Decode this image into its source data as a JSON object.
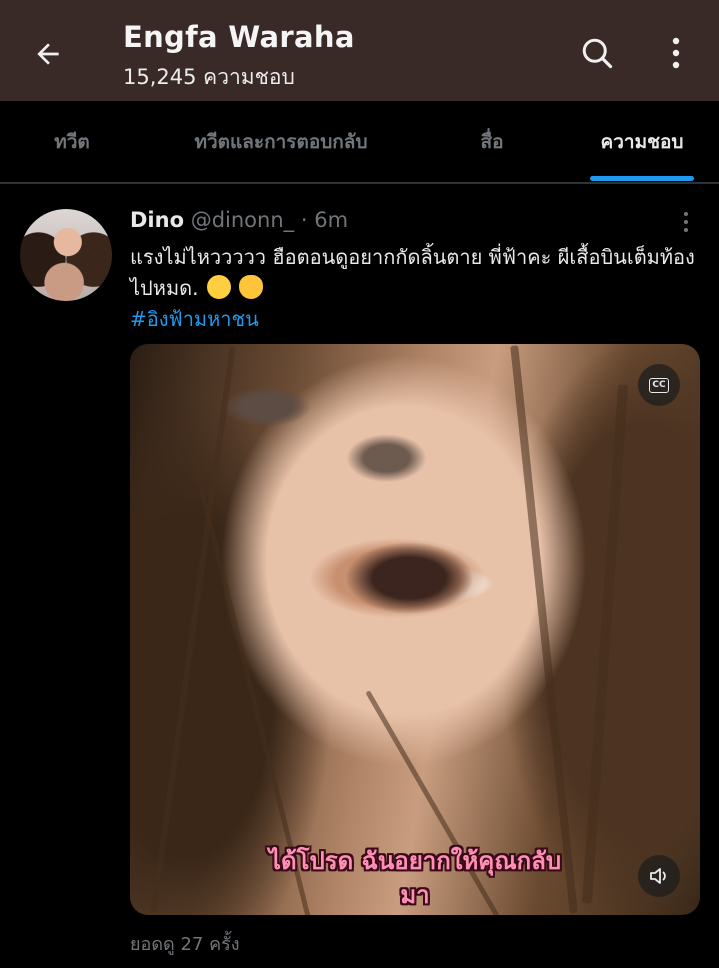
{
  "header": {
    "title": "Engfa Waraha",
    "likes_count": "15,245 ความชอบ",
    "back_icon": "arrow-left-icon",
    "search_icon": "search-icon",
    "more_icon": "more-vertical-icon",
    "background": "#3a2a27"
  },
  "tabs": [
    {
      "label": "ทวีต",
      "active": false
    },
    {
      "label": "ทวีตและการตอบกลับ",
      "active": false
    },
    {
      "label": "สื่อ",
      "active": false
    },
    {
      "label": "ความชอบ",
      "active": true
    }
  ],
  "accent": "#1d9bf0",
  "tweet": {
    "name": "Dino",
    "handle": "@dinonn_",
    "separator": "·",
    "time": "6m",
    "text": "แรงไม่ไหววววว ฮือตอนดูอยากกัดลิ้นตาย พี่ฟ้าคะ ผีเสื้อบินเต็มท้องไปหมด.",
    "emojis": [
      "pleading-face-icon",
      "hugging-face-icon"
    ],
    "hashtag": "#อิงฟ้ามหาชน",
    "media": {
      "cc_label": "CC",
      "subtitle_line1": "ได้โปรด ฉันอยากให้คุณกลับ",
      "subtitle_line2": "มา",
      "volume_icon": "volume-icon"
    },
    "views": "ยอดดู 27 ครั้ง"
  }
}
